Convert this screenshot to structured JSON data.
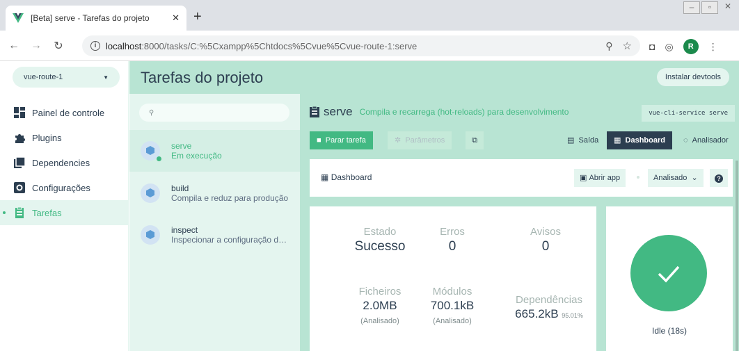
{
  "browser": {
    "tab_title": "[Beta] serve - Tarefas do projeto",
    "close_glyph": "✕",
    "new_tab_glyph": "+",
    "url_host": "localhost",
    "url_path": ":8000/tasks/C:%5Cxampp%5Chtdocs%5Cvue%5Cvue-route-1:serve",
    "avatar_initial": "R"
  },
  "sidebar": {
    "project": "vue-route-1",
    "items": [
      {
        "label": "Painel de controle",
        "icon": "dashboard-icon"
      },
      {
        "label": "Plugins",
        "icon": "puzzle-icon"
      },
      {
        "label": "Dependencies",
        "icon": "library-icon"
      },
      {
        "label": "Configurações",
        "icon": "settings-icon"
      },
      {
        "label": "Tarefas",
        "icon": "tasks-icon",
        "active": true
      }
    ]
  },
  "header": {
    "title": "Tarefas do projeto",
    "devtools_label": "Instalar devtools"
  },
  "tasks": {
    "search_placeholder": "",
    "items": [
      {
        "name": "serve",
        "description": "Em execução",
        "selected": true,
        "running": true
      },
      {
        "name": "build",
        "description": "Compila e reduz para produção"
      },
      {
        "name": "inspect",
        "description": "Inspecionar a configuração do webpack"
      }
    ]
  },
  "task_detail": {
    "name": "serve",
    "description": "Compila e recarrega (hot-reloads) para desenvolvimento",
    "command": "vue-cli-service serve",
    "toolbar": {
      "stop": "Parar tarefa",
      "params": "Parâmetros",
      "output": "Saída",
      "dashboard": "Dashboard",
      "analyzer": "Analisador"
    },
    "dashboard": {
      "title": "Dashboard",
      "open_app": "Abrir app",
      "mode": "Analisado"
    },
    "stats": {
      "estado_label": "Estado",
      "estado_value": "Sucesso",
      "erros_label": "Erros",
      "erros_value": "0",
      "avisos_label": "Avisos",
      "avisos_value": "0",
      "ficheiros_label": "Ficheiros",
      "ficheiros_value": "2.0MB",
      "ficheiros_sub": "(Analisado)",
      "modulos_label": "Módulos",
      "modulos_value": "700.1kB",
      "modulos_sub": "(Analisado)",
      "deps_label": "Dependências",
      "deps_value": "665.2kB",
      "deps_pct": "95.01%"
    },
    "status": "Idle (18s)"
  },
  "colors": {
    "accent": "#42b983",
    "dark": "#2c3e50",
    "panel": "#b8e4d3",
    "light": "#e4f5ef"
  }
}
